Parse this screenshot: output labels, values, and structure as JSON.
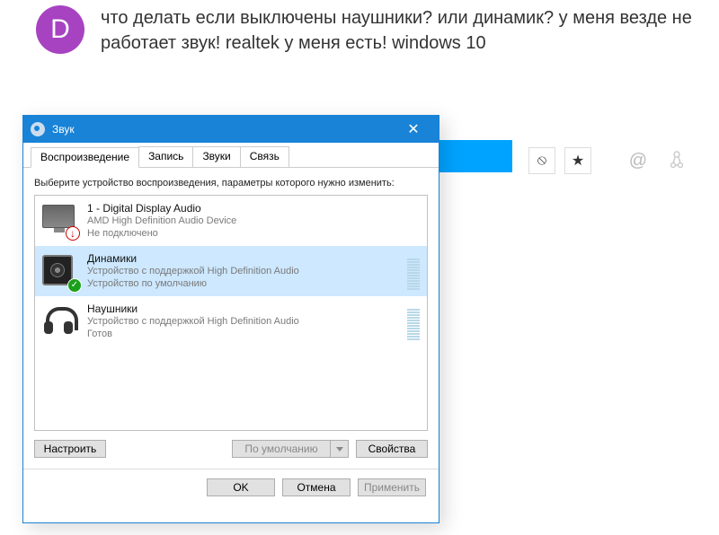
{
  "avatar_letter": "D",
  "question": "что делать если выключены наушники? или динамик? у меня везде не работает звук! realtek у меня есть! windows 10",
  "bg_icons": {
    "block": "⦸",
    "star": "★",
    "at": "@"
  },
  "dialog": {
    "title": "Звук",
    "close": "✕",
    "tabs": [
      "Воспроизведение",
      "Запись",
      "Звуки",
      "Связь"
    ],
    "prompt": "Выберите устройство воспроизведения, параметры которого нужно изменить:",
    "devices": [
      {
        "name": "1 - Digital Display Audio",
        "line2": "AMD High Definition Audio Device",
        "line3": "Не подключено",
        "icon": "monitor",
        "badge": "down"
      },
      {
        "name": "Динамики",
        "line2": "Устройство с поддержкой High Definition Audio",
        "line3": "Устройство по умолчанию",
        "icon": "speaker",
        "badge": "check",
        "selected": true
      },
      {
        "name": "Наушники",
        "line2": "Устройство с поддержкой High Definition Audio",
        "line3": "Готов",
        "icon": "headphones"
      }
    ],
    "buttons": {
      "configure": "Настроить",
      "default": "По умолчанию",
      "properties": "Свойства",
      "ok": "OK",
      "cancel": "Отмена",
      "apply": "Применить"
    }
  }
}
